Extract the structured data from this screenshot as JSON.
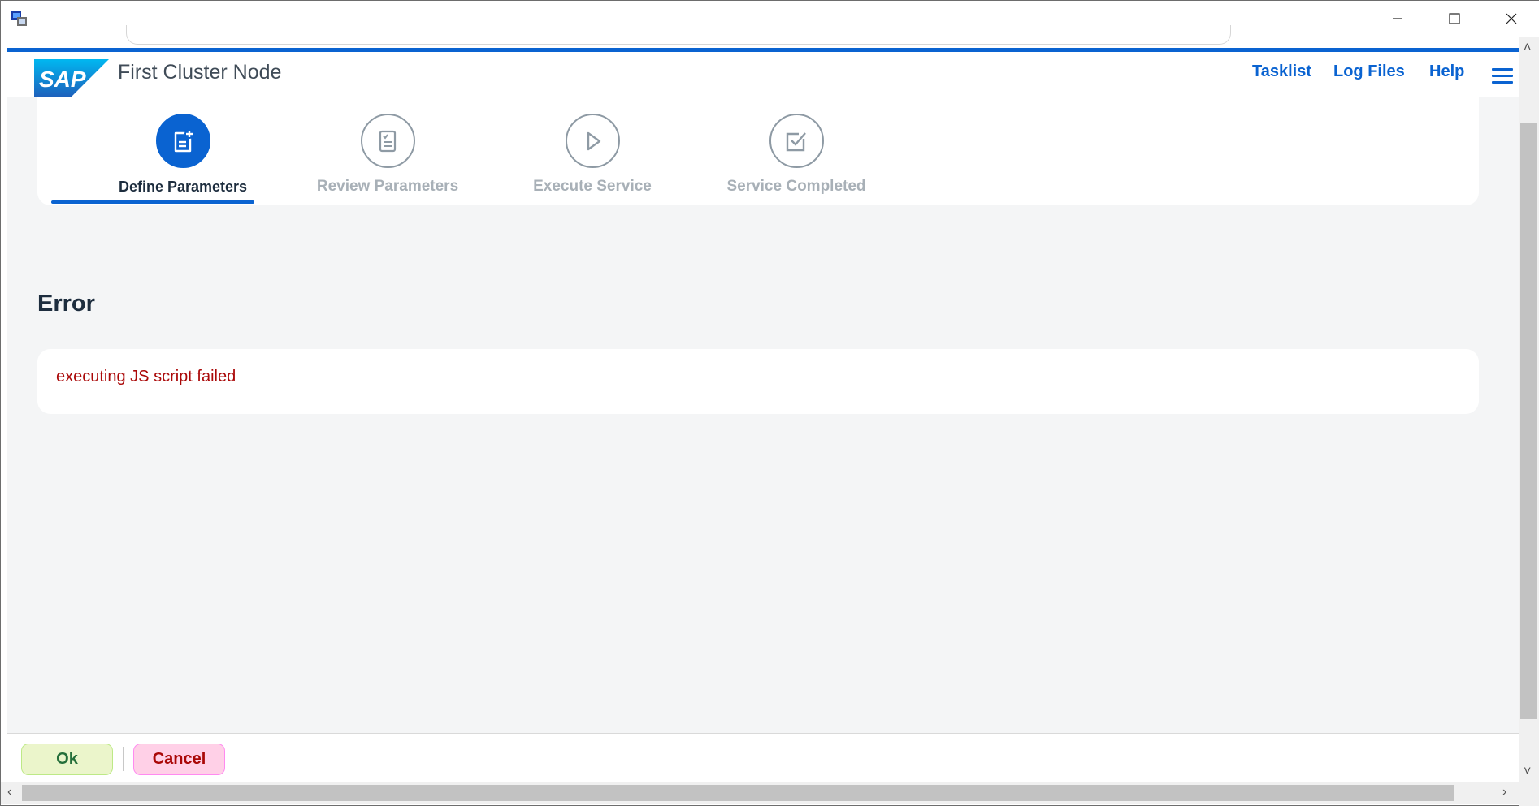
{
  "window": {
    "minimize_icon": "minimize-icon",
    "maximize_icon": "maximize-icon",
    "close_icon": "close-icon"
  },
  "header": {
    "logo_text": "SAP",
    "title": "First Cluster Node",
    "links": {
      "tasklist": "Tasklist",
      "log_files": "Log Files",
      "help": "Help"
    },
    "menu_icon": "hamburger-menu-icon"
  },
  "steps": [
    {
      "label": "Define Parameters",
      "icon": "add-document-icon",
      "state": "active"
    },
    {
      "label": "Review Parameters",
      "icon": "checklist-document-icon",
      "state": "inactive"
    },
    {
      "label": "Execute Service",
      "icon": "play-icon",
      "state": "inactive"
    },
    {
      "label": "Service Completed",
      "icon": "checkbox-checked-icon",
      "state": "inactive"
    }
  ],
  "error": {
    "heading": "Error",
    "message": "executing JS script failed"
  },
  "footer": {
    "ok_label": "Ok",
    "cancel_label": "Cancel"
  },
  "colors": {
    "brand_blue": "#0a63d1",
    "error_red": "#aa0808",
    "ok_bg": "#ebf5cb",
    "cancel_bg": "#ffd0e7"
  }
}
